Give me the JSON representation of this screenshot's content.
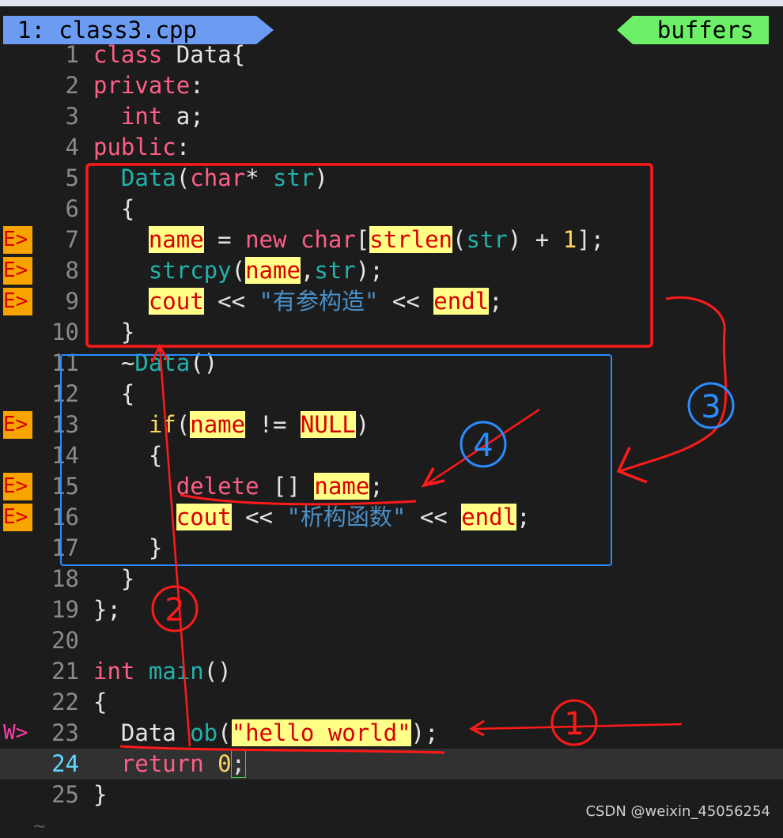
{
  "tab": {
    "label": "1: class3.cpp"
  },
  "buffers_label": "buffers",
  "lines": [
    {
      "n": "1",
      "sign": "",
      "tokens": [
        {
          "t": "class",
          "c": "kw"
        },
        {
          "t": " Data{",
          "c": ""
        }
      ]
    },
    {
      "n": "2",
      "sign": "",
      "tokens": [
        {
          "t": "private",
          "c": "kw"
        },
        {
          "t": ":",
          "c": ""
        }
      ]
    },
    {
      "n": "3",
      "sign": "",
      "tokens": [
        {
          "t": "  ",
          "c": ""
        },
        {
          "t": "int",
          "c": "ty"
        },
        {
          "t": " a;",
          "c": ""
        }
      ]
    },
    {
      "n": "4",
      "sign": "",
      "tokens": [
        {
          "t": "public",
          "c": "kw"
        },
        {
          "t": ":",
          "c": ""
        }
      ]
    },
    {
      "n": "5",
      "sign": "",
      "tokens": [
        {
          "t": "  ",
          "c": ""
        },
        {
          "t": "Data",
          "c": "fn"
        },
        {
          "t": "(",
          "c": ""
        },
        {
          "t": "char",
          "c": "ty"
        },
        {
          "t": "* ",
          "c": ""
        },
        {
          "t": "str",
          "c": "fn"
        },
        {
          "t": ")",
          "c": ""
        }
      ]
    },
    {
      "n": "6",
      "sign": "",
      "tokens": [
        {
          "t": "  {",
          "c": ""
        }
      ]
    },
    {
      "n": "7",
      "sign": "E>",
      "tokens": [
        {
          "t": "    ",
          "c": ""
        },
        {
          "t": "name",
          "c": "hl"
        },
        {
          "t": " = ",
          "c": ""
        },
        {
          "t": "new",
          "c": "kw"
        },
        {
          "t": " ",
          "c": ""
        },
        {
          "t": "char",
          "c": "ty"
        },
        {
          "t": "[",
          "c": ""
        },
        {
          "t": "strlen",
          "c": "hl"
        },
        {
          "t": "(",
          "c": ""
        },
        {
          "t": "str",
          "c": "fn"
        },
        {
          "t": ") + ",
          "c": ""
        },
        {
          "t": "1",
          "c": "num"
        },
        {
          "t": "];",
          "c": ""
        }
      ]
    },
    {
      "n": "8",
      "sign": "E>",
      "tokens": [
        {
          "t": "    ",
          "c": ""
        },
        {
          "t": "strcpy",
          "c": "fn"
        },
        {
          "t": "(",
          "c": ""
        },
        {
          "t": "name",
          "c": "hl"
        },
        {
          "t": ",",
          "c": ""
        },
        {
          "t": "str",
          "c": "fn"
        },
        {
          "t": ");",
          "c": ""
        }
      ]
    },
    {
      "n": "9",
      "sign": "E>",
      "tokens": [
        {
          "t": "    ",
          "c": ""
        },
        {
          "t": "cout",
          "c": "hl"
        },
        {
          "t": " << ",
          "c": ""
        },
        {
          "t": "\"有参构造\"",
          "c": "str"
        },
        {
          "t": " << ",
          "c": ""
        },
        {
          "t": "endl",
          "c": "hl"
        },
        {
          "t": ";",
          "c": ""
        }
      ]
    },
    {
      "n": "10",
      "sign": "",
      "tokens": [
        {
          "t": "  }",
          "c": ""
        }
      ]
    },
    {
      "n": "11",
      "sign": "",
      "tokens": [
        {
          "t": "  ~",
          "c": ""
        },
        {
          "t": "Data",
          "c": "fn"
        },
        {
          "t": "()",
          "c": ""
        }
      ]
    },
    {
      "n": "12",
      "sign": "",
      "tokens": [
        {
          "t": "  {",
          "c": ""
        }
      ]
    },
    {
      "n": "13",
      "sign": "E>",
      "tokens": [
        {
          "t": "    ",
          "c": ""
        },
        {
          "t": "if",
          "c": "num"
        },
        {
          "t": "(",
          "c": ""
        },
        {
          "t": "name",
          "c": "hl"
        },
        {
          "t": " != ",
          "c": ""
        },
        {
          "t": "NULL",
          "c": "hl"
        },
        {
          "t": ")",
          "c": ""
        }
      ]
    },
    {
      "n": "14",
      "sign": "",
      "tokens": [
        {
          "t": "    {",
          "c": ""
        }
      ]
    },
    {
      "n": "15",
      "sign": "E>",
      "tokens": [
        {
          "t": "      ",
          "c": ""
        },
        {
          "t": "delete",
          "c": "kw"
        },
        {
          "t": " [] ",
          "c": ""
        },
        {
          "t": "name",
          "c": "hl"
        },
        {
          "t": ";",
          "c": ""
        }
      ]
    },
    {
      "n": "16",
      "sign": "E>",
      "tokens": [
        {
          "t": "      ",
          "c": ""
        },
        {
          "t": "cout",
          "c": "hl"
        },
        {
          "t": " << ",
          "c": ""
        },
        {
          "t": "\"析构函数\"",
          "c": "str"
        },
        {
          "t": " << ",
          "c": ""
        },
        {
          "t": "endl",
          "c": "hl"
        },
        {
          "t": ";",
          "c": ""
        }
      ]
    },
    {
      "n": "17",
      "sign": "",
      "tokens": [
        {
          "t": "    }",
          "c": ""
        }
      ]
    },
    {
      "n": "18",
      "sign": "",
      "tokens": [
        {
          "t": "  }",
          "c": ""
        }
      ]
    },
    {
      "n": "19",
      "sign": "",
      "tokens": [
        {
          "t": "};",
          "c": ""
        }
      ]
    },
    {
      "n": "20",
      "sign": "",
      "tokens": []
    },
    {
      "n": "21",
      "sign": "",
      "tokens": [
        {
          "t": "int",
          "c": "ty"
        },
        {
          "t": " ",
          "c": ""
        },
        {
          "t": "main",
          "c": "fn"
        },
        {
          "t": "()",
          "c": ""
        }
      ]
    },
    {
      "n": "22",
      "sign": "",
      "tokens": [
        {
          "t": "{",
          "c": ""
        }
      ]
    },
    {
      "n": "23",
      "sign": "W>",
      "tokens": [
        {
          "t": "  Data ",
          "c": ""
        },
        {
          "t": "ob",
          "c": "fn"
        },
        {
          "t": "(",
          "c": ""
        },
        {
          "t": "\"hello world\"",
          "c": "hl"
        },
        {
          "t": ");",
          "c": ""
        }
      ]
    },
    {
      "n": "24",
      "sign": "",
      "cursor": true,
      "tokens": [
        {
          "t": "  ",
          "c": ""
        },
        {
          "t": "return",
          "c": "kw"
        },
        {
          "t": " ",
          "c": ""
        },
        {
          "t": "0",
          "c": "num"
        },
        {
          "t": ";",
          "c": "cur-box"
        }
      ]
    },
    {
      "n": "25",
      "sign": "",
      "tokens": [
        {
          "t": "}",
          "c": ""
        }
      ]
    }
  ],
  "annotations": {
    "n1": "①",
    "n2": "②",
    "n3": "③",
    "n4": "④",
    "red_color": "#ff1a1a",
    "blue_color": "#2a8cff"
  },
  "watermark": "CSDN @weixin_45056254",
  "tilde": "~"
}
